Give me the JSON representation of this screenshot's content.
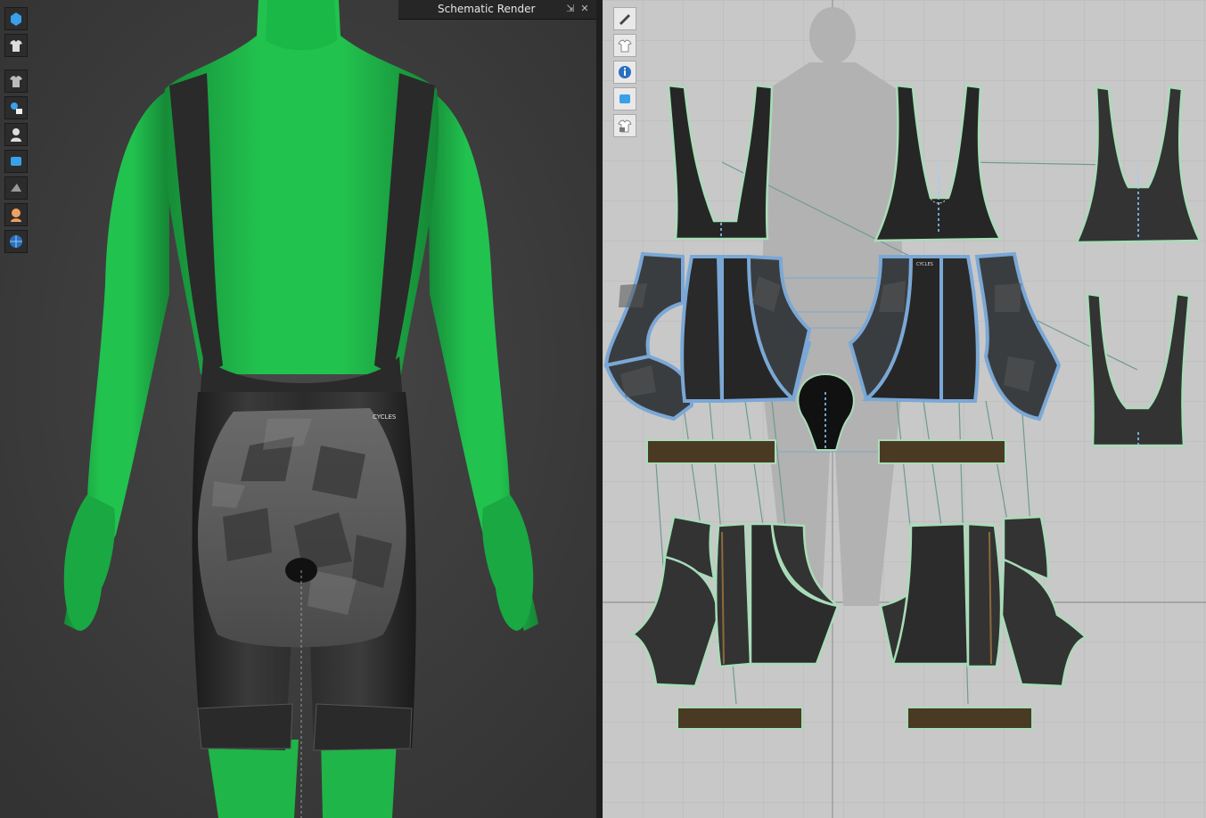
{
  "window": {
    "title": "Schematic Render"
  },
  "viewport_3d": {
    "toolbar": [
      {
        "icon": "cube-icon"
      },
      {
        "icon": "shirt-icon"
      },
      {
        "icon": "garment-icon"
      },
      {
        "icon": "avatar-paint-icon"
      },
      {
        "icon": "avatar-icon"
      },
      {
        "icon": "fabric-icon"
      },
      {
        "icon": "shadow-icon"
      },
      {
        "icon": "skin-icon"
      },
      {
        "icon": "globe-icon"
      }
    ],
    "brand_print": "CYCLES"
  },
  "viewport_2d": {
    "toolbar": [
      {
        "icon": "pen-eye-icon"
      },
      {
        "icon": "garment-eye-icon"
      },
      {
        "icon": "info-eye-icon"
      },
      {
        "icon": "fabric-view-icon"
      },
      {
        "icon": "locked-garment-icon"
      }
    ],
    "brand_print": "CYCLES"
  },
  "colors": {
    "avatar": "#1fbf4a",
    "garment": "#2b2b2b",
    "pattern_dark": "#2f2f2f",
    "pattern_outline": "#a9dcb8",
    "selected_outline": "#7aa8d6",
    "band": "#4a3a24",
    "grid_bg": "#c8c8c8"
  }
}
